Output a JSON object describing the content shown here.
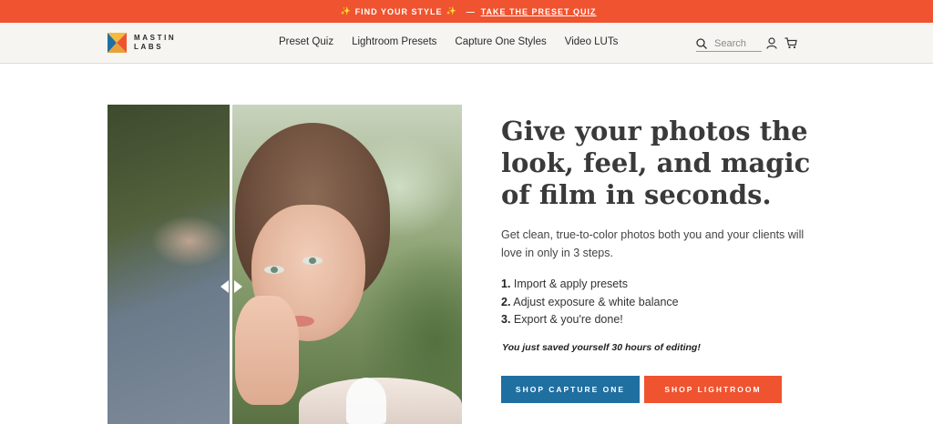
{
  "announcement": {
    "text": "FIND YOUR STYLE",
    "separator": "—",
    "link_label": "TAKE THE PRESET QUIZ",
    "spark_icon": "sparkle-icon"
  },
  "header": {
    "logo_line1": "MASTIN",
    "logo_line2": "LABS",
    "nav": [
      {
        "label": "Preset Quiz"
      },
      {
        "label": "Lightroom Presets"
      },
      {
        "label": "Capture One Styles"
      },
      {
        "label": "Video LUTs"
      }
    ],
    "search_placeholder": "Search",
    "icons": [
      "search-icon",
      "account-icon",
      "cart-icon"
    ]
  },
  "hero": {
    "image_alt": "Before and after comparison of a bride portrait",
    "headline": "Give your photos the look, feel, and magic of film in seconds.",
    "subtext": "Get clean, true-to-color photos both you and your clients will love in only in 3 steps.",
    "steps": [
      {
        "num": "1.",
        "text": "Import & apply presets"
      },
      {
        "num": "2.",
        "text": "Adjust exposure & white balance"
      },
      {
        "num": "3.",
        "text": "Export & you're done!"
      }
    ],
    "saved_note": "You just saved yourself 30 hours of editing!",
    "buttons": {
      "capture_one": "SHOP CAPTURE ONE",
      "lightroom": "SHOP LIGHTROOM"
    }
  },
  "colors": {
    "accent_orange": "#f0532f",
    "accent_blue": "#1f6fa1",
    "header_bg": "#f6f5f1",
    "spark": "#ffd24a"
  }
}
